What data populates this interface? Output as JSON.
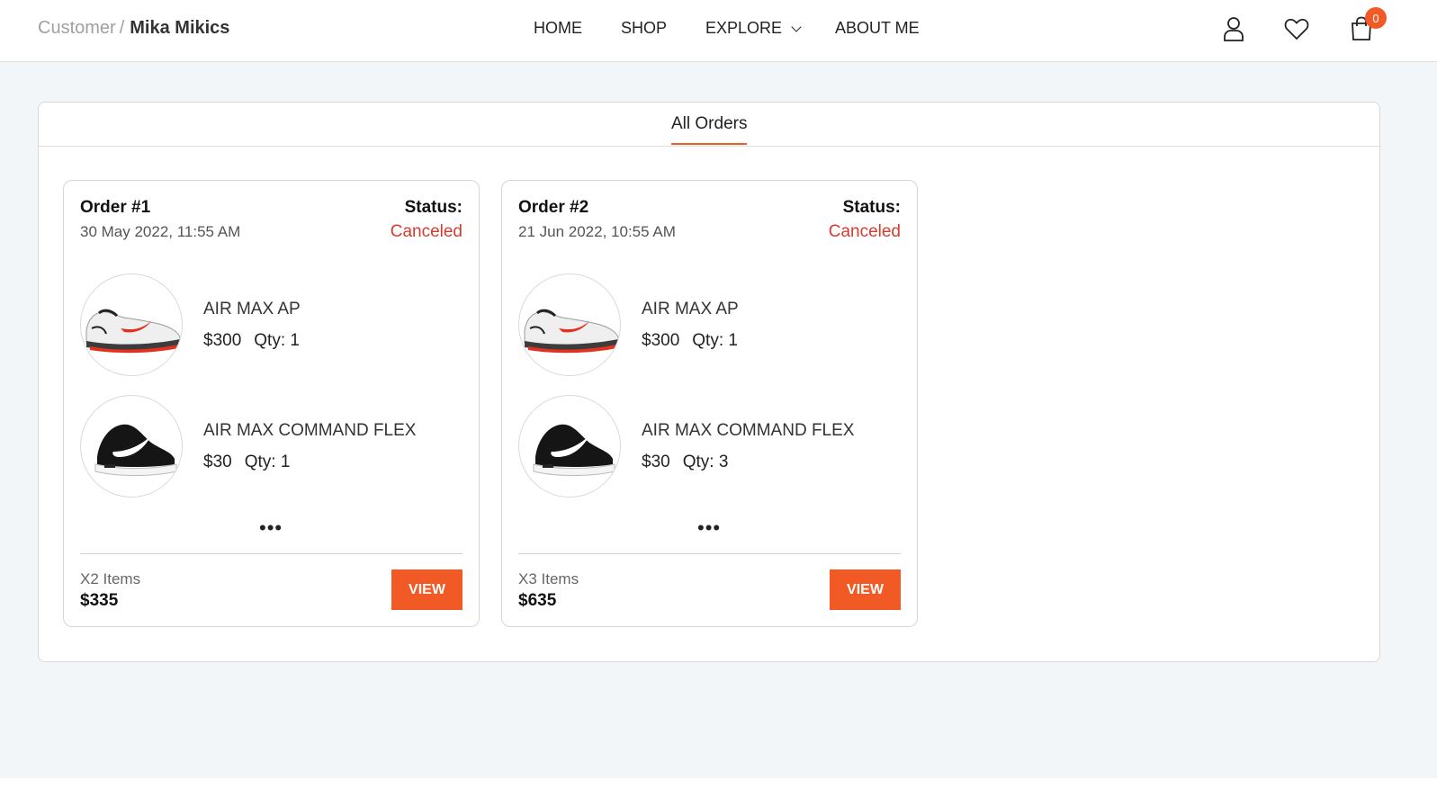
{
  "breadcrumb": {
    "root": "Customer",
    "separator": "/",
    "current": "Mika Mikics"
  },
  "nav": {
    "home": "HOME",
    "shop": "SHOP",
    "explore": "EXPLORE",
    "about": "ABOUT ME"
  },
  "header_icons": {
    "account": "user-icon",
    "wishlist": "heart-icon",
    "cart": "shopping-bag-icon",
    "cart_count": "0"
  },
  "tabs": {
    "active": "All Orders"
  },
  "orders": [
    {
      "title": "Order #1",
      "date": "30 May 2022, 11:55 AM",
      "status_label": "Status:",
      "status": "Canceled",
      "items": [
        {
          "name": "AIR MAX AP",
          "price": "$300",
          "qty": "Qty: 1",
          "image": "white-red-sneaker"
        },
        {
          "name": "AIR MAX COMMAND FLEX",
          "price": "$30",
          "qty": "Qty: 1",
          "image": "black-sneaker"
        }
      ],
      "more": "•••",
      "count": "X2 Items",
      "total": "$335",
      "view": "VIEW"
    },
    {
      "title": "Order #2",
      "date": "21 Jun 2022, 10:55 AM",
      "status_label": "Status:",
      "status": "Canceled",
      "items": [
        {
          "name": "AIR MAX AP",
          "price": "$300",
          "qty": "Qty: 1",
          "image": "white-red-sneaker"
        },
        {
          "name": "AIR MAX COMMAND FLEX",
          "price": "$30",
          "qty": "Qty: 3",
          "image": "black-sneaker"
        }
      ],
      "more": "•••",
      "count": "X3 Items",
      "total": "$635",
      "view": "VIEW"
    }
  ],
  "colors": {
    "accent": "#f15a24",
    "status_canceled": "#d63b2f",
    "page_bg": "#f3f6f9"
  }
}
